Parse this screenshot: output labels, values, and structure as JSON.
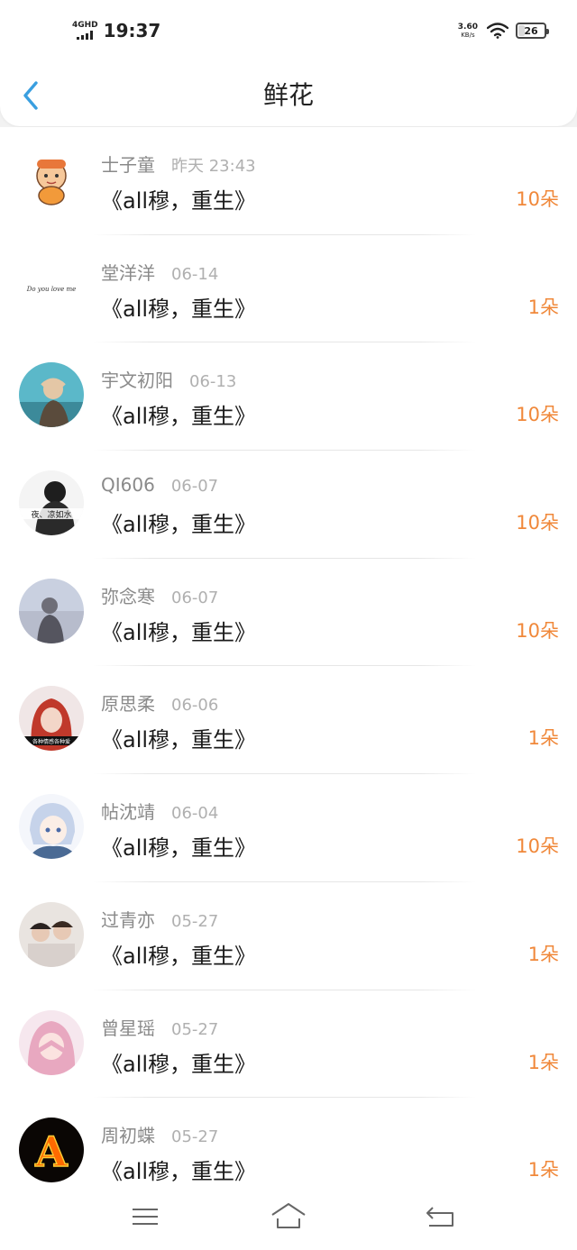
{
  "status_bar": {
    "network": "4GHD",
    "time": "19:37",
    "speed_value": "3.60",
    "speed_unit": "KB/s",
    "battery": "26",
    "battery_level_percent": 26
  },
  "header": {
    "title": "鲜花",
    "back_icon": "chevron-left-icon"
  },
  "colors": {
    "accent_blue": "#3a9fe0",
    "flower_orange": "#f0883a",
    "name_gray": "#8a8a8a",
    "date_gray": "#b0b0b0"
  },
  "items": [
    {
      "name": "士子童",
      "date": "昨天 23:43",
      "book": "《all穆，重生》",
      "flowers": "10朵",
      "avatar": "cartoon-avatar"
    },
    {
      "name": "堂洋洋",
      "date": "06-14",
      "book": "《all穆，重生》",
      "flowers": "1朵",
      "avatar": "handwriting-avatar",
      "avatar_text": "Do you love me"
    },
    {
      "name": "宇文初阳",
      "date": "06-13",
      "book": "《all穆，重生》",
      "flowers": "10朵",
      "avatar": "photo-avatar"
    },
    {
      "name": "QI606",
      "date": "06-07",
      "book": "《all穆，重生》",
      "flowers": "10朵",
      "avatar": "photo-avatar",
      "avatar_text": "夜、凉如水"
    },
    {
      "name": "弥念寒",
      "date": "06-07",
      "book": "《all穆，重生》",
      "flowers": "10朵",
      "avatar": "photo-avatar"
    },
    {
      "name": "原思柔",
      "date": "06-06",
      "book": "《all穆，重生》",
      "flowers": "1朵",
      "avatar": "photo-avatar"
    },
    {
      "name": "帖沈靖",
      "date": "06-04",
      "book": "《all穆，重生》",
      "flowers": "10朵",
      "avatar": "anime-avatar"
    },
    {
      "name": "过青亦",
      "date": "05-27",
      "book": "《all穆，重生》",
      "flowers": "1朵",
      "avatar": "photo-avatar"
    },
    {
      "name": "曾星瑶",
      "date": "05-27",
      "book": "《all穆，重生》",
      "flowers": "1朵",
      "avatar": "anime-avatar"
    },
    {
      "name": "周初蝶",
      "date": "05-27",
      "book": "《all穆，重生》",
      "flowers": "1朵",
      "avatar": "fire-letter-avatar",
      "avatar_text": "A"
    }
  ],
  "nav_bar": {
    "menu_icon": "menu-icon",
    "home_icon": "home-icon",
    "back_icon": "back-icon"
  }
}
